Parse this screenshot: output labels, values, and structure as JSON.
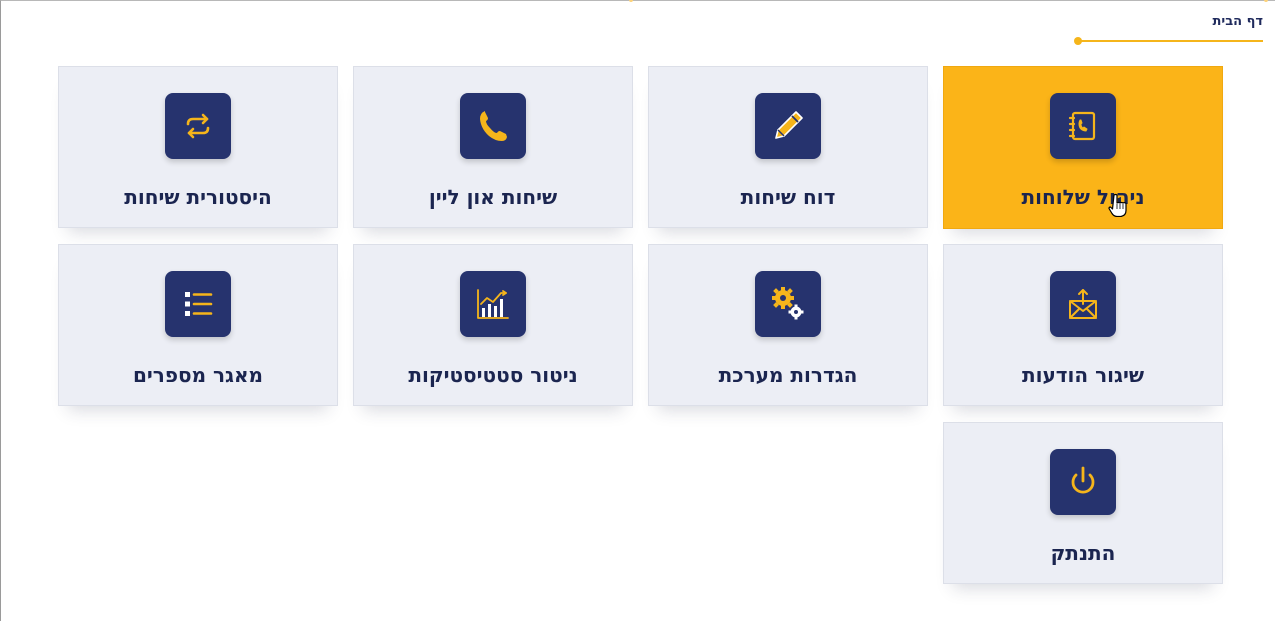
{
  "breadcrumb": {
    "label": "דף הבית"
  },
  "colors": {
    "accent": "#fbb418",
    "tile_background": "#eceef5",
    "icon_background": "#26336e",
    "text": "#1b2550"
  },
  "tiles": [
    {
      "label": "ניהול שלוחות",
      "icon": "phonebook-icon",
      "active": true
    },
    {
      "label": "דוח שיחות",
      "icon": "pencil-icon",
      "active": false
    },
    {
      "label": "שיחות און ליין",
      "icon": "phone-icon",
      "active": false
    },
    {
      "label": "היסטורית שיחות",
      "icon": "repeat-icon",
      "active": false
    },
    {
      "label": "שיגור הודעות",
      "icon": "envelope-upload-icon",
      "active": false
    },
    {
      "label": "הגדרות מערכת",
      "icon": "gears-icon",
      "active": false
    },
    {
      "label": "ניטור סטטיסטיקות",
      "icon": "chart-icon",
      "active": false
    },
    {
      "label": "מאגר מספרים",
      "icon": "list-icon",
      "active": false
    },
    {
      "label": "התנתק",
      "icon": "power-icon",
      "active": false
    }
  ]
}
